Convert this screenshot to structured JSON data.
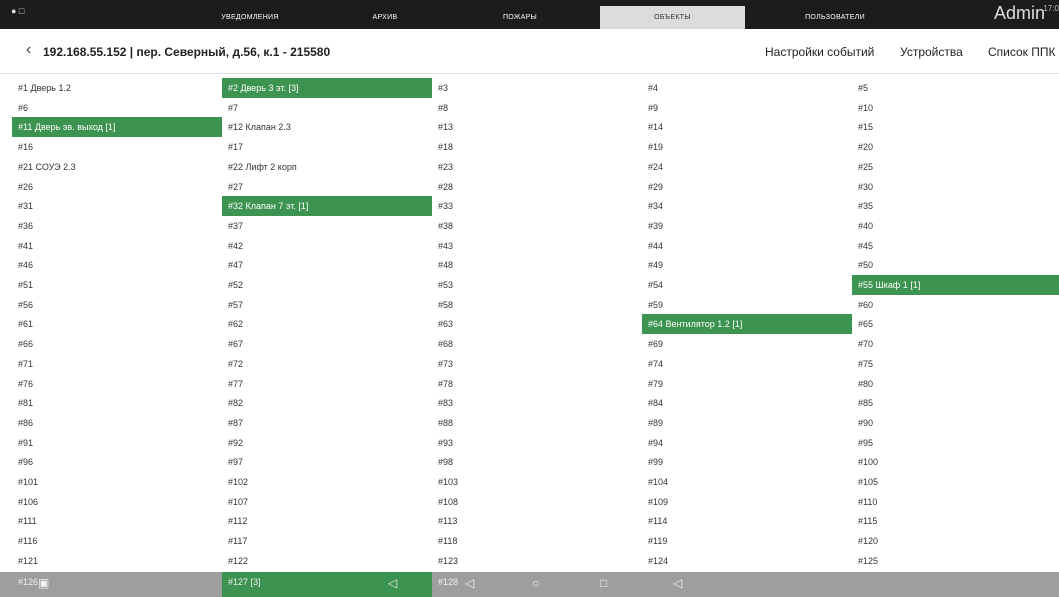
{
  "topbar": {
    "tabs": [
      "УВЕДОМЛЕНИЯ",
      "АРХИВ",
      "ПОЖАРЫ",
      "ОБЪЕКТЫ",
      "ПОЛЬЗОВАТЕЛИ"
    ],
    "active_tab": "ОБЪЕКТЫ",
    "user": "Admin",
    "clock": "17:0"
  },
  "header": {
    "title": "192.168.55.152 | пер. Северный, д.56, к.1 - 215580",
    "links": [
      "Настройки событий",
      "Устройства",
      "Список ППК"
    ]
  },
  "cells": {
    "1": "#1  Дверь 1.2",
    "2": "#2 Дверь 3 эт. [3]",
    "11": "#11 Дверь эв. выход [1]",
    "12": "#12 Клапан 2.3",
    "21": "#21 СОУЭ 2.3",
    "22": "#22 Лифт 2 корп",
    "32": "#32  Клапан 7 эт. [1]",
    "55": "#55 Шкаф 1 [1]",
    "64": "#64 Вентилятор 1.2 [1]"
  },
  "highlighted": [
    2,
    11,
    32,
    55,
    64
  ],
  "navbar": {
    "cells": [
      "#126",
      "#127 [3]",
      "#128"
    ],
    "icons": [
      "camera-icon",
      "volume-icon",
      "back-icon",
      "home-icon",
      "recents-icon",
      "volume-icon"
    ]
  },
  "colors": {
    "highlight": "#3d9350",
    "topbar": "#1c1c1c",
    "navbar": "#9e9e9e"
  }
}
